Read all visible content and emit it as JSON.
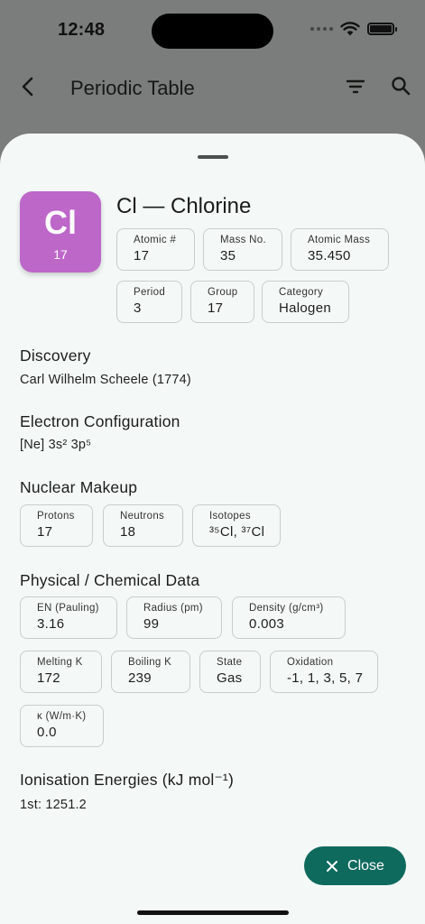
{
  "status_bar": {
    "time": "12:48",
    "icons": [
      "cellular-dots-icon",
      "wifi-icon",
      "battery-icon"
    ]
  },
  "appbar": {
    "title": "Periodic Table",
    "icons": [
      "back-arrow-icon",
      "filter-icon",
      "search-icon"
    ]
  },
  "element": {
    "symbol": "Cl",
    "number": "17",
    "title": "Cl — Chlorine",
    "color": "#bd67c9",
    "stats_row1": [
      {
        "label": "Atomic #",
        "value": "17"
      },
      {
        "label": "Mass No.",
        "value": "35"
      },
      {
        "label": "Atomic Mass",
        "value": "35.450"
      }
    ],
    "stats_row2": [
      {
        "label": "Period",
        "value": "3"
      },
      {
        "label": "Group",
        "value": "17"
      },
      {
        "label": "Category",
        "value": "Halogen"
      }
    ]
  },
  "discovery": {
    "title": "Discovery",
    "text": "Carl Wilhelm Scheele (1774)"
  },
  "electron_config": {
    "title": "Electron Configuration",
    "text": "[Ne] 3s² 3p⁵"
  },
  "nuclear": {
    "title": "Nuclear Makeup",
    "items": [
      {
        "label": "Protons",
        "value": "17"
      },
      {
        "label": "Neutrons",
        "value": "18"
      },
      {
        "label": "Isotopes",
        "value": "³⁵Cl, ³⁷Cl"
      }
    ]
  },
  "physical": {
    "title": "Physical / Chemical Data",
    "row1": [
      {
        "label": "EN (Pauling)",
        "value": "3.16"
      },
      {
        "label": "Radius (pm)",
        "value": "99"
      },
      {
        "label": "Density (g/cm³)",
        "value": "0.003"
      }
    ],
    "row2": [
      {
        "label": "Melting K",
        "value": "172"
      },
      {
        "label": "Boiling K",
        "value": "239"
      },
      {
        "label": "State",
        "value": "Gas"
      },
      {
        "label": "Oxidation",
        "value": "-1, 1, 3, 5, 7"
      }
    ],
    "row3": [
      {
        "label": "κ (W/m·K)",
        "value": "0.0"
      }
    ]
  },
  "ionisation": {
    "title": "Ionisation Energies (kJ mol⁻¹)",
    "text": "1st: 1251.2"
  },
  "close_button": {
    "label": "Close",
    "color": "#0f6a5e"
  }
}
